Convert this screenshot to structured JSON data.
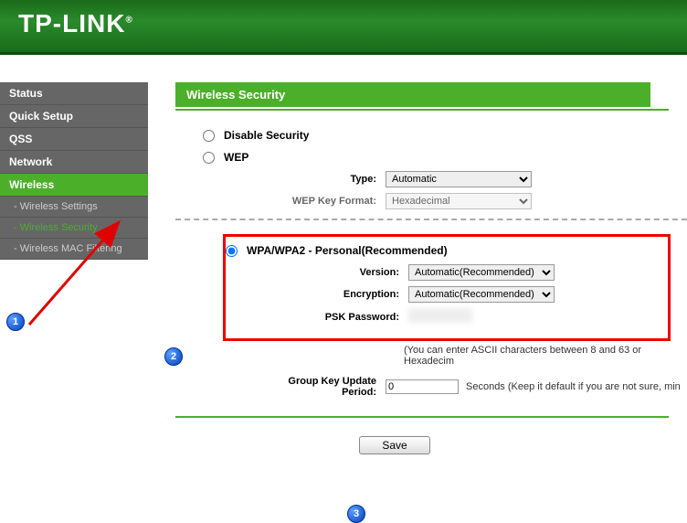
{
  "brand": "TP-LINK",
  "sidebar": {
    "items": [
      {
        "label": "Status",
        "active": false
      },
      {
        "label": "Quick Setup",
        "active": false
      },
      {
        "label": "QSS",
        "active": false
      },
      {
        "label": "Network",
        "active": false
      },
      {
        "label": "Wireless",
        "active": true
      }
    ],
    "subitems": [
      {
        "label": "- Wireless Settings",
        "active": false
      },
      {
        "label": "- Wireless Security",
        "active": true
      },
      {
        "label": "- Wireless MAC Filtering",
        "active": false
      }
    ]
  },
  "page": {
    "title": "Wireless Security"
  },
  "security": {
    "disable_label": "Disable Security",
    "wep": {
      "label": "WEP",
      "type_label": "Type:",
      "type_value": "Automatic",
      "keyformat_label": "WEP Key Format:",
      "keyformat_value": "Hexadecimal"
    },
    "wpa": {
      "label": "WPA/WPA2 - Personal(Recommended)",
      "version_label": "Version:",
      "version_value": "Automatic(Recommended)",
      "encryption_label": "Encryption:",
      "encryption_value": "Automatic(Recommended)",
      "psk_label": "PSK Password:",
      "psk_value": "",
      "hint": "(You can enter ASCII characters between 8 and 63 or Hexadecim",
      "group_key_label": "Group Key Update Period:",
      "group_key_value": "0",
      "group_key_note": "Seconds (Keep it default if you are not sure, min"
    }
  },
  "buttons": {
    "save": "Save"
  },
  "annotations": {
    "b1": "1",
    "b2": "2",
    "b3": "3"
  }
}
